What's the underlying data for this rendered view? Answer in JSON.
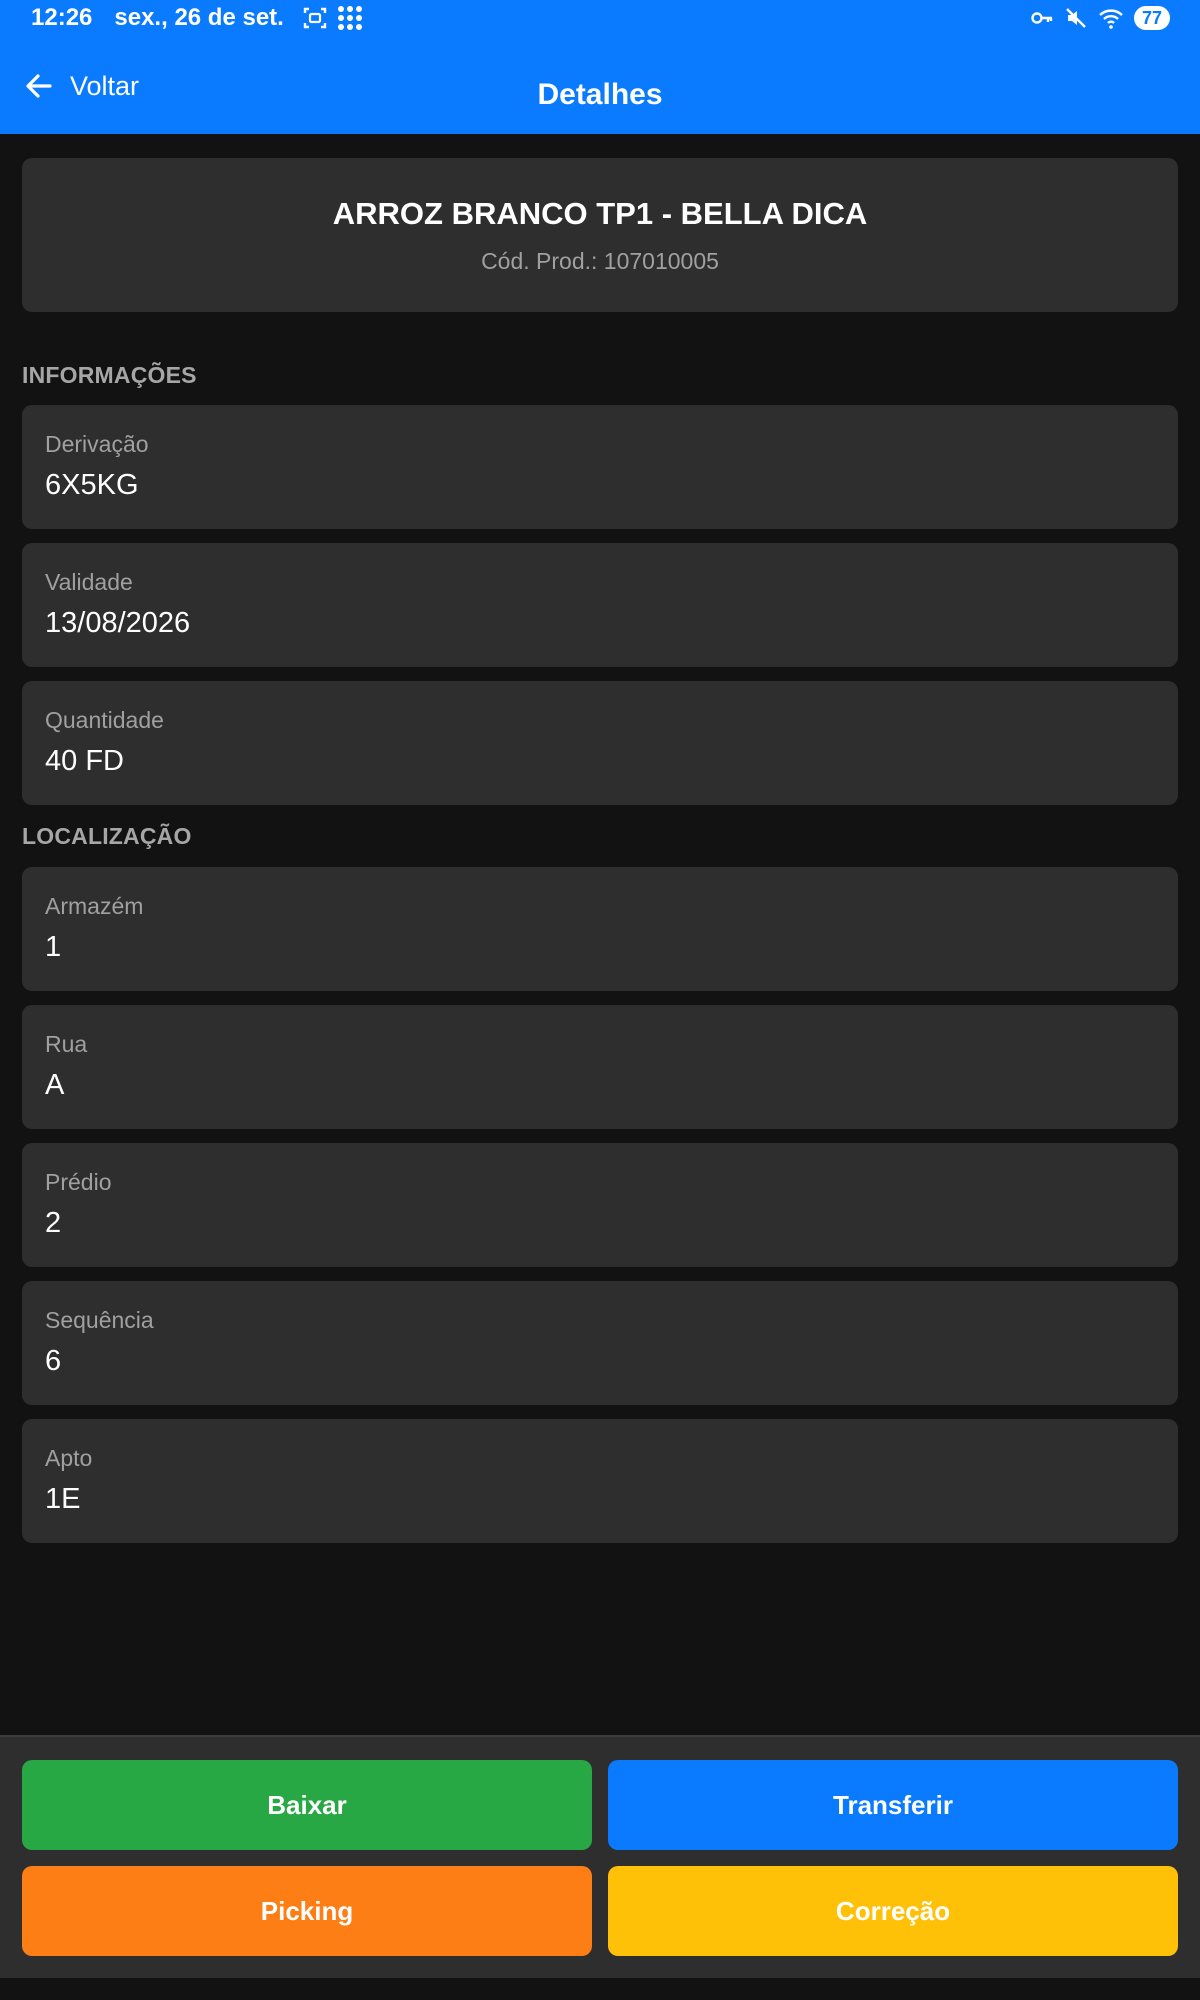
{
  "status": {
    "time": "12:26",
    "date": "sex., 26 de set.",
    "battery": "77",
    "icons_left": [
      "screenshot-icon",
      "apps-grid-icon"
    ],
    "icons_right": [
      "key-icon",
      "mute-icon",
      "wifi-icon",
      "battery-icon"
    ]
  },
  "nav": {
    "back_label": "Voltar",
    "title": "Detalhes"
  },
  "product": {
    "name": "ARROZ BRANCO TP1 - BELLA DICA",
    "code": "Cód. Prod.: 107010005"
  },
  "sections": {
    "info_title": "INFORMAÇÕES",
    "location_title": "LOCALIZAÇÃO"
  },
  "info": [
    {
      "label": "Derivação",
      "value": "6X5KG"
    },
    {
      "label": "Validade",
      "value": "13/08/2026"
    },
    {
      "label": "Quantidade",
      "value": "40 FD"
    }
  ],
  "location": [
    {
      "label": "Armazém",
      "value": "1"
    },
    {
      "label": "Rua",
      "value": "A"
    },
    {
      "label": "Prédio",
      "value": "2"
    },
    {
      "label": "Sequência",
      "value": "6"
    },
    {
      "label": "Apto",
      "value": "1E"
    }
  ],
  "actions": {
    "baixar": "Baixar",
    "transferir": "Transferir",
    "picking": "Picking",
    "correcao": "Correção"
  },
  "colors": {
    "primary": "#0a7bff",
    "success": "#28a745",
    "orange": "#fd7e14",
    "warning": "#ffc107",
    "background": "#121212",
    "card": "#2e2e2e"
  }
}
